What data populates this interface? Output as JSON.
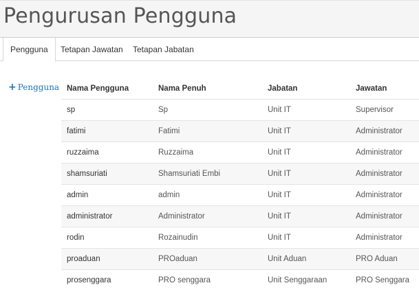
{
  "header": {
    "title": "Pengurusan Pengguna"
  },
  "tabs": [
    {
      "label": "Pengguna"
    },
    {
      "label": "Tetapan Jawatan"
    },
    {
      "label": "Tetapan Jabatan"
    }
  ],
  "actions": {
    "add_icon": "plus-icon",
    "add_label": "Pengguna"
  },
  "colors": {
    "link": "#1a75bb"
  },
  "table": {
    "headers": [
      "Nama Pengguna",
      "Nama Penuh",
      "Jabatan",
      "Jawatan"
    ],
    "rows": [
      [
        "sp",
        "Sp",
        "Unit IT",
        "Supervisor"
      ],
      [
        "fatimi",
        "Fatimi",
        "Unit IT",
        "Administrator"
      ],
      [
        "ruzzaima",
        "Ruzzaima",
        "Unit IT",
        "Administrator"
      ],
      [
        "shamsuriati",
        "Shamsuriati Embi",
        "Unit IT",
        "Administrator"
      ],
      [
        "admin",
        "admin",
        "Unit IT",
        "Administrator"
      ],
      [
        "administrator",
        "Administrator",
        "Unit IT",
        "Administrator"
      ],
      [
        "rodin",
        "Rozainudin",
        "Unit IT",
        "Administrator"
      ],
      [
        "proaduan",
        "PROaduan",
        "Unit Aduan",
        "PRO Aduan"
      ],
      [
        "prosenggara",
        "PRO senggara",
        "Unit Senggaraan",
        "PRO Senggara"
      ]
    ]
  }
}
